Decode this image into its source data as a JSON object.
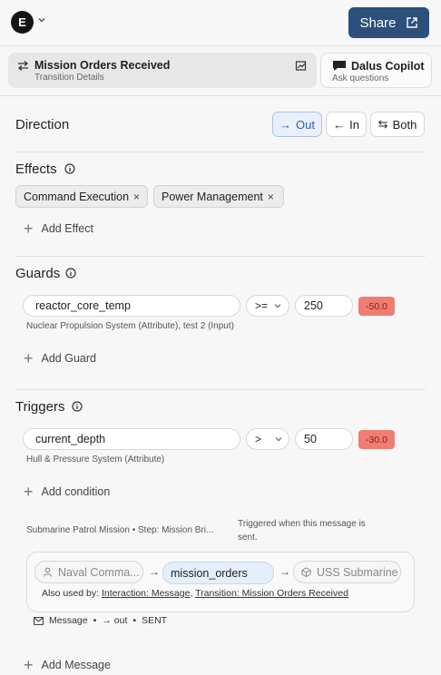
{
  "header": {
    "avatar_letter": "E",
    "share_label": "Share"
  },
  "tabs": {
    "main_title": "Mission Orders Received",
    "main_subtitle": "Transition Details",
    "copilot_title": "Dalus Copilot",
    "copilot_subtitle": "Ask questions"
  },
  "direction": {
    "title": "Direction",
    "options": [
      {
        "label": "Out",
        "icon": "arrow-right-icon",
        "active": true
      },
      {
        "label": "In",
        "icon": "arrow-left-icon",
        "active": false
      },
      {
        "label": "Both",
        "icon": "swap-icon",
        "active": false
      }
    ]
  },
  "effects": {
    "title": "Effects",
    "chips": [
      "Command Execution",
      "Power Management"
    ],
    "add_label": "Add Effect"
  },
  "guards": {
    "title": "Guards",
    "variable": "reactor_core_temp",
    "operator": ">=",
    "value": "250",
    "badge": "-50.0",
    "source": "Nuclear Propulsion System (Attribute), test 2 (Input)",
    "add_label": "Add Guard"
  },
  "triggers": {
    "title": "Triggers",
    "variable": "current_depth",
    "operator": ">",
    "value": "50",
    "badge": "-30.0",
    "source": "Hull & Pressure System (Attribute)",
    "add_label": "Add condition",
    "context": "Submarine Patrol Mission • Step: Mission Bri...",
    "note_line1": "Triggered when this message is",
    "note_line2": "sent.",
    "message": {
      "from": "Naval Comma...",
      "name": "mission_orders",
      "to": "USS Submarine",
      "used_by_prefix": "Also used by:",
      "used_by": [
        "Interaction: Message",
        "Transition: Mission Orders Received"
      ],
      "meta_type": "Message",
      "meta_dir": "out",
      "meta_status": "SENT"
    },
    "add_message_label": "Add Message"
  },
  "colors": {
    "share_bg": "#2c4f7c",
    "badge_bg": "#ef7d73",
    "active_dir": "#2d5fb4"
  }
}
